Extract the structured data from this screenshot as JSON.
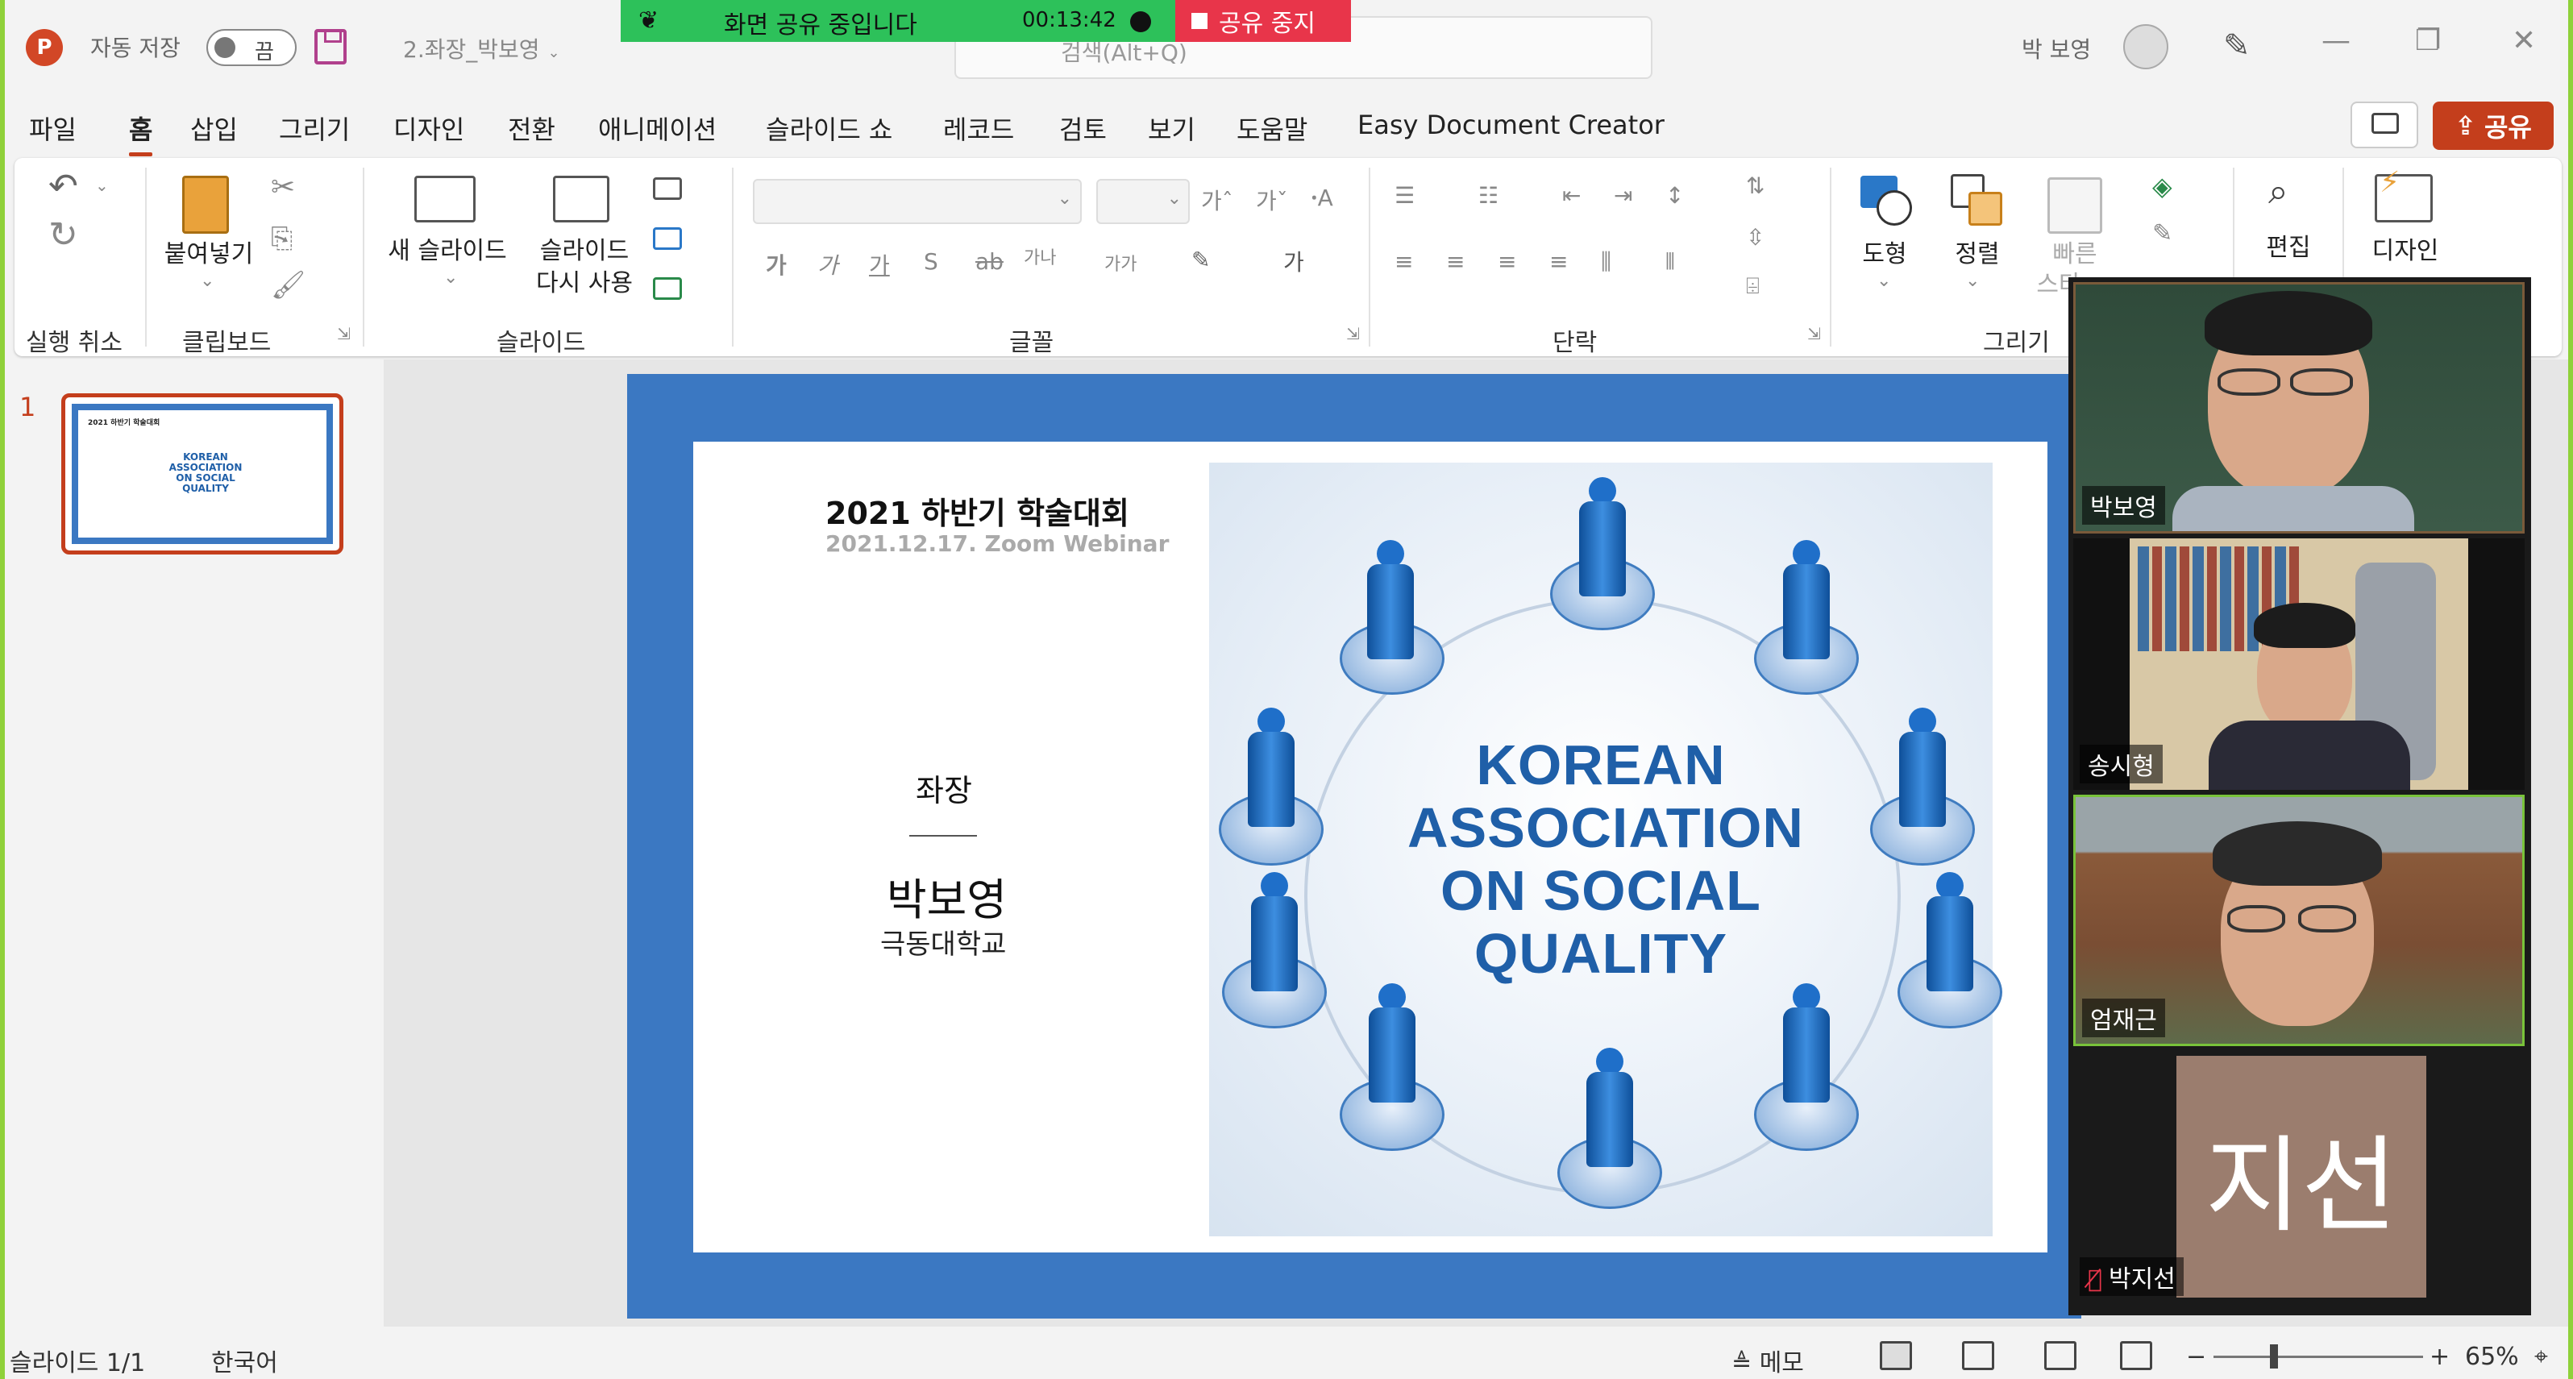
{
  "titlebar": {
    "app_icon": "P",
    "autosave_label": "자동 저장",
    "toggle_label": "끔",
    "doc_title": "2.좌장_박보영",
    "search_placeholder": "검색(Alt+Q)",
    "user_name": "박 보영",
    "minimize": "—",
    "restore": "❐",
    "close": "✕"
  },
  "zoom_share": {
    "status": "화면 공유 중입니다",
    "timer": "00:13:42",
    "stop_label": "공유 중지"
  },
  "menu": {
    "items": [
      "파일",
      "홈",
      "삽입",
      "그리기",
      "디자인",
      "전환",
      "애니메이션",
      "슬라이드 쇼",
      "레코드",
      "검토",
      "보기",
      "도움말",
      "Easy Document Creator"
    ],
    "active": "홈",
    "share_label": "공유"
  },
  "ribbon": {
    "groups": {
      "undo": "실행 취소",
      "clipboard": "클립보드",
      "slides": "슬라이드",
      "font": "글꼴",
      "paragraph": "단락",
      "drawing": "그리기"
    },
    "paste_label": "붙여넣기",
    "new_slide_label": "새 슬라이드",
    "reuse_slide_label_1": "슬라이드",
    "reuse_slide_label_2": "다시 사용",
    "shapes_label": "도형",
    "arrange_label": "정렬",
    "quick_styles_label": "빠른",
    "quick_styles_label_2": "스타",
    "edit_label": "편집",
    "designer_label": "디자인"
  },
  "thumbnails": {
    "slide_number": "1",
    "thumb_title": "2021 하반기 학술대회",
    "thumb_text": "KOREAN ASSOCIATION ON SOCIAL QUALITY"
  },
  "slide": {
    "title": "2021 하반기 학술대회",
    "date": "2021.12.17. Zoom Webinar",
    "role": "좌장",
    "name": "박보영",
    "org": "극동대학교",
    "logo_lines": [
      "KOREAN",
      "ASSOCIATION",
      "ON SOCIAL",
      "QUALITY"
    ]
  },
  "participants": [
    {
      "name": "박보영",
      "active": false
    },
    {
      "name": "송시형",
      "active": false
    },
    {
      "name": "엄재근",
      "active": true
    },
    {
      "name": "박지선",
      "active": false,
      "avatar_text": "지선",
      "muted": true
    }
  ],
  "statusbar": {
    "slide_info": "슬라이드 1/1",
    "language": "한국어",
    "notes_label": "메모",
    "zoom_level": "65%"
  }
}
